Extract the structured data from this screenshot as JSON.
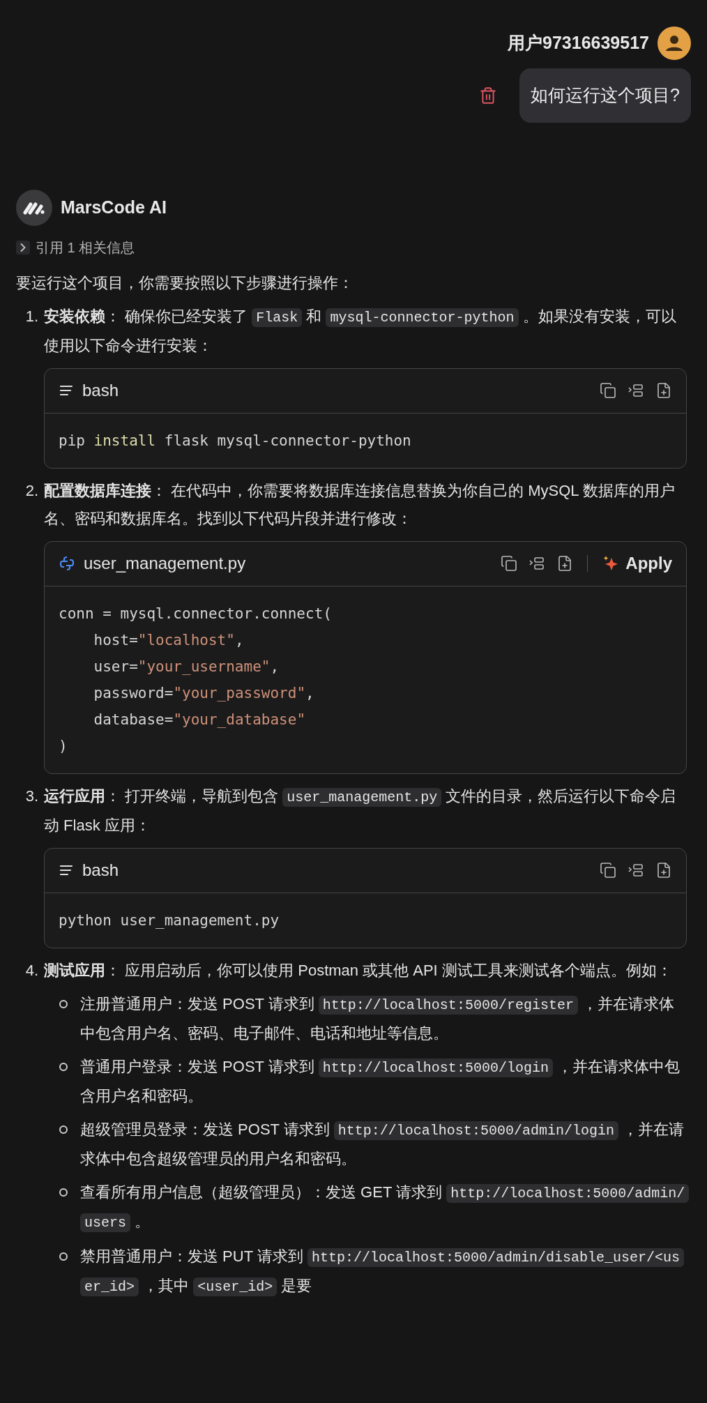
{
  "user": {
    "name": "用户97316639517",
    "message": "如何运行这个项目?"
  },
  "assistant": {
    "name": "MarsCode AI",
    "reference": "引用 1 相关信息",
    "intro": "要运行这个项目，你需要按照以下步骤进行操作：",
    "steps": [
      {
        "number": "1.",
        "segments": [
          {
            "kind": "text",
            "text": "**安装依赖**：  确保你已经安装了 "
          },
          {
            "kind": "code",
            "text": "Flask"
          },
          {
            "kind": "text",
            "text": " 和 "
          },
          {
            "kind": "code",
            "text": "mysql-connector-python"
          },
          {
            "kind": "text",
            "text": " 。如果没有安装，可以使用以下命令进行安装："
          }
        ],
        "code_block": {
          "kind": "shell",
          "label": "bash",
          "lines": [
            [
              {
                "kind": "plain",
                "text": "pip "
              },
              {
                "kind": "keyword",
                "text": "install"
              },
              {
                "kind": "plain",
                "text": " flask mysql-connector-python"
              }
            ]
          ]
        }
      },
      {
        "number": "2.",
        "segments": [
          {
            "kind": "text",
            "text": "**配置数据库连接**：  在代码中，你需要将数据库连接信息替换为你自己的 MySQL 数据库的用户名、密码和数据库名。找到以下代码片段并进行修改："
          }
        ],
        "code_block": {
          "kind": "file",
          "label": "user_management.py",
          "apply": "Apply",
          "lines": [
            [
              {
                "kind": "plain",
                "text": "conn = mysql.connector.connect("
              }
            ],
            [
              {
                "kind": "plain",
                "text": "    host="
              },
              {
                "kind": "string",
                "text": "\"localhost\""
              },
              {
                "kind": "plain",
                "text": ","
              }
            ],
            [
              {
                "kind": "plain",
                "text": "    user="
              },
              {
                "kind": "string",
                "text": "\"your_username\""
              },
              {
                "kind": "plain",
                "text": ","
              }
            ],
            [
              {
                "kind": "plain",
                "text": "    password="
              },
              {
                "kind": "string",
                "text": "\"your_password\""
              },
              {
                "kind": "plain",
                "text": ","
              }
            ],
            [
              {
                "kind": "plain",
                "text": "    database="
              },
              {
                "kind": "string",
                "text": "\"your_database\""
              }
            ],
            [
              {
                "kind": "plain",
                "text": ")"
              }
            ]
          ]
        }
      },
      {
        "number": "3.",
        "segments": [
          {
            "kind": "text",
            "text": "**运行应用**：  打开终端，导航到包含 "
          },
          {
            "kind": "code",
            "text": "user_management.py"
          },
          {
            "kind": "text",
            "text": " 文件的目录，然后运行以下命令启动 Flask 应用："
          }
        ],
        "code_block": {
          "kind": "shell",
          "label": "bash",
          "lines": [
            [
              {
                "kind": "plain",
                "text": "python user_management.py"
              }
            ]
          ]
        }
      },
      {
        "number": "4.",
        "segments": [
          {
            "kind": "text",
            "text": "**测试应用**：  应用启动后，你可以使用 Postman 或其他 API 测试工具来测试各个端点。例如："
          }
        ],
        "bullets": [
          [
            {
              "kind": "text",
              "text": "注册普通用户：发送 POST 请求到 "
            },
            {
              "kind": "code",
              "text": "http://localhost:5000/register"
            },
            {
              "kind": "text",
              "text": " ，并在请求体中包含用户名、密码、电子邮件、电话和地址等信息。"
            }
          ],
          [
            {
              "kind": "text",
              "text": "普通用户登录：发送 POST 请求到 "
            },
            {
              "kind": "code",
              "text": "http://localhost:5000/login"
            },
            {
              "kind": "text",
              "text": " ，并在请求体中包含用户名和密码。"
            }
          ],
          [
            {
              "kind": "text",
              "text": "超级管理员登录：发送 POST 请求到 "
            },
            {
              "kind": "code",
              "text": "http://localhost:5000/admin/login"
            },
            {
              "kind": "text",
              "text": " ，并在请求体中包含超级管理员的用户名和密码。"
            }
          ],
          [
            {
              "kind": "text",
              "text": "查看所有用户信息（超级管理员）：发送 GET 请求到 "
            },
            {
              "kind": "code",
              "text": "http://localhost:5000/admin/users"
            },
            {
              "kind": "text",
              "text": " 。"
            }
          ],
          [
            {
              "kind": "text",
              "text": "禁用普通用户：发送 PUT 请求到 "
            },
            {
              "kind": "code",
              "text": "http://localhost:5000/admin/disable_user/<user_id>"
            },
            {
              "kind": "text",
              "text": " ，其中 "
            },
            {
              "kind": "code",
              "text": "<user_id>"
            },
            {
              "kind": "text",
              "text": " 是要"
            }
          ]
        ]
      }
    ]
  }
}
